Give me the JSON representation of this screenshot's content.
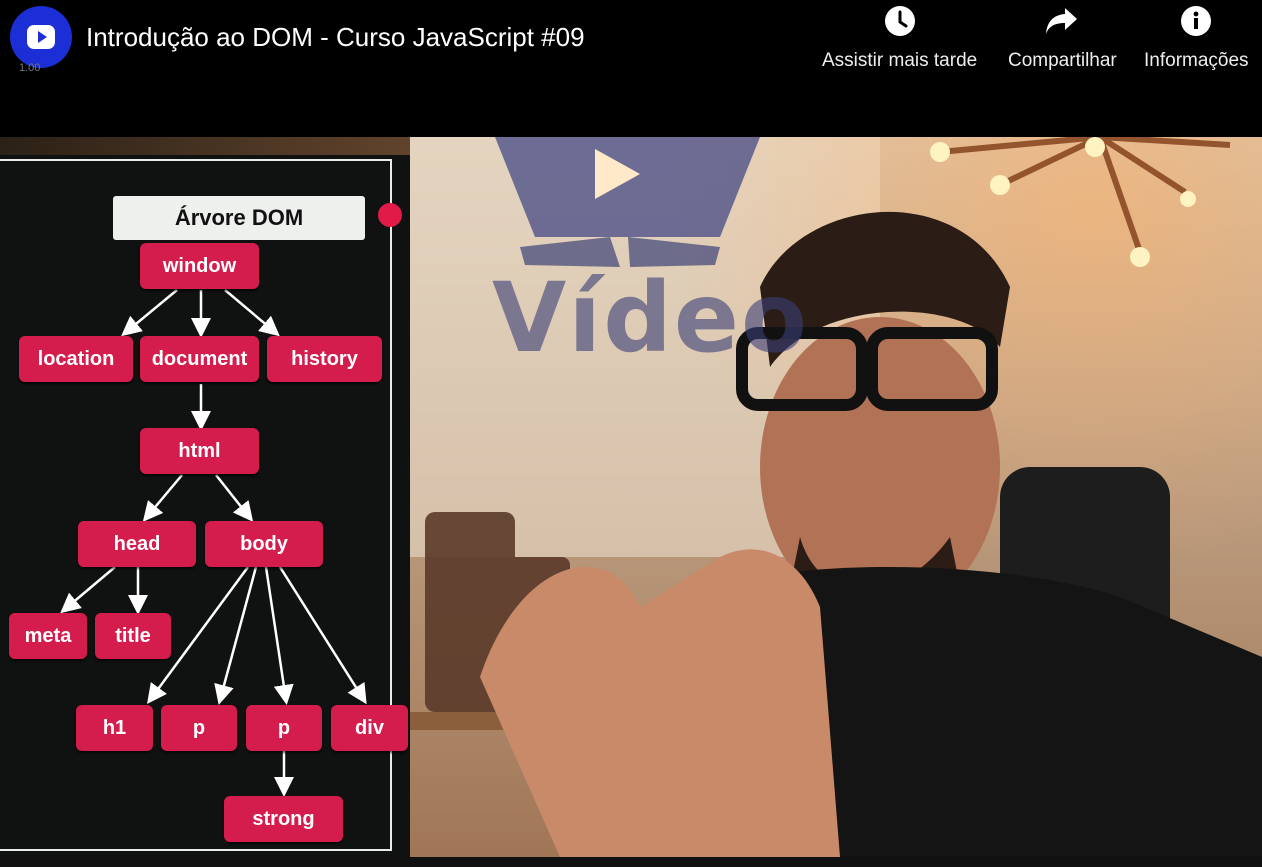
{
  "header": {
    "title": "Introdução ao DOM - Curso JavaScript #09",
    "zoom": "1.00",
    "actions": {
      "watch_later": "Assistir mais tarde",
      "share": "Compartilhar",
      "info": "Informações"
    }
  },
  "slide": {
    "title": "Árvore DOM",
    "nodes": {
      "window": "window",
      "location": "location",
      "document": "document",
      "history": "history",
      "html": "html",
      "head": "head",
      "body": "body",
      "meta": "meta",
      "title": "title",
      "h1": "h1",
      "p1": "p",
      "p2": "p",
      "div": "div",
      "strong": "strong"
    }
  },
  "background": {
    "sign_text": "Vídeo"
  },
  "colors": {
    "node": "#d41c4d",
    "logo": "#1c2fd6",
    "rec": "#e11a47"
  },
  "icons": [
    "youtube-logo-icon",
    "clock-icon",
    "share-icon",
    "info-icon"
  ]
}
